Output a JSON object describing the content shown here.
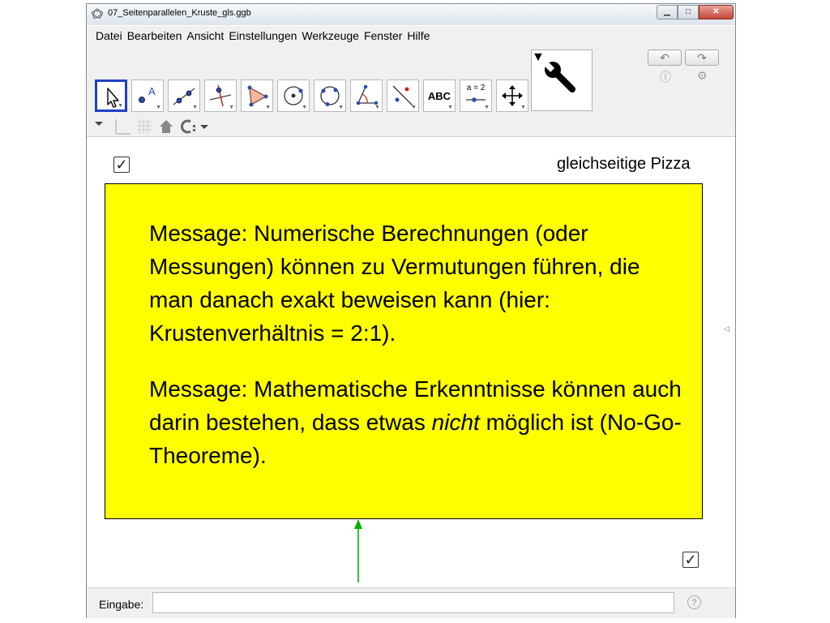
{
  "window": {
    "title": "07_Seitenparallelen_Kruste_gls.ggb"
  },
  "menu": [
    "Datei",
    "Bearbeiten",
    "Ansicht",
    "Einstellungen",
    "Werkzeuge",
    "Fenster",
    "Hilfe"
  ],
  "tools": [
    {
      "name": "move-tool-icon",
      "selected": true
    },
    {
      "name": "point-tool-icon"
    },
    {
      "name": "line-tool-icon"
    },
    {
      "name": "perpendicular-line-tool-icon"
    },
    {
      "name": "polygon-tool-icon"
    },
    {
      "name": "circle-center-point-tool-icon"
    },
    {
      "name": "circle-three-points-tool-icon"
    },
    {
      "name": "angle-tool-icon"
    },
    {
      "name": "reflect-tool-icon"
    },
    {
      "name": "text-tool-icon",
      "text": "ABC"
    },
    {
      "name": "slider-tool-icon",
      "text": "a = 2"
    },
    {
      "name": "move-view-tool-icon"
    }
  ],
  "graphics": {
    "pizza_label": "gleichseitige Pizza",
    "checkbox_top_checked": true,
    "checkbox_bottom_checked": true,
    "message1": "Message: Numerische Berechnungen (oder Messungen) können zu Vermutungen führen, die man danach exakt beweisen kann (hier: Krustenverhältnis = 2:1).",
    "message2_italic": "nicht",
    "message2_before": "Message: Mathematische Erkenntnisse können auch darin bestehen, dass etwas",
    "message2_after": "möglich ist (No-Go-Theoreme).",
    "box_color": "#ffff00",
    "arrow_color": "#00b000"
  },
  "input": {
    "label": "Eingabe:",
    "value": ""
  }
}
